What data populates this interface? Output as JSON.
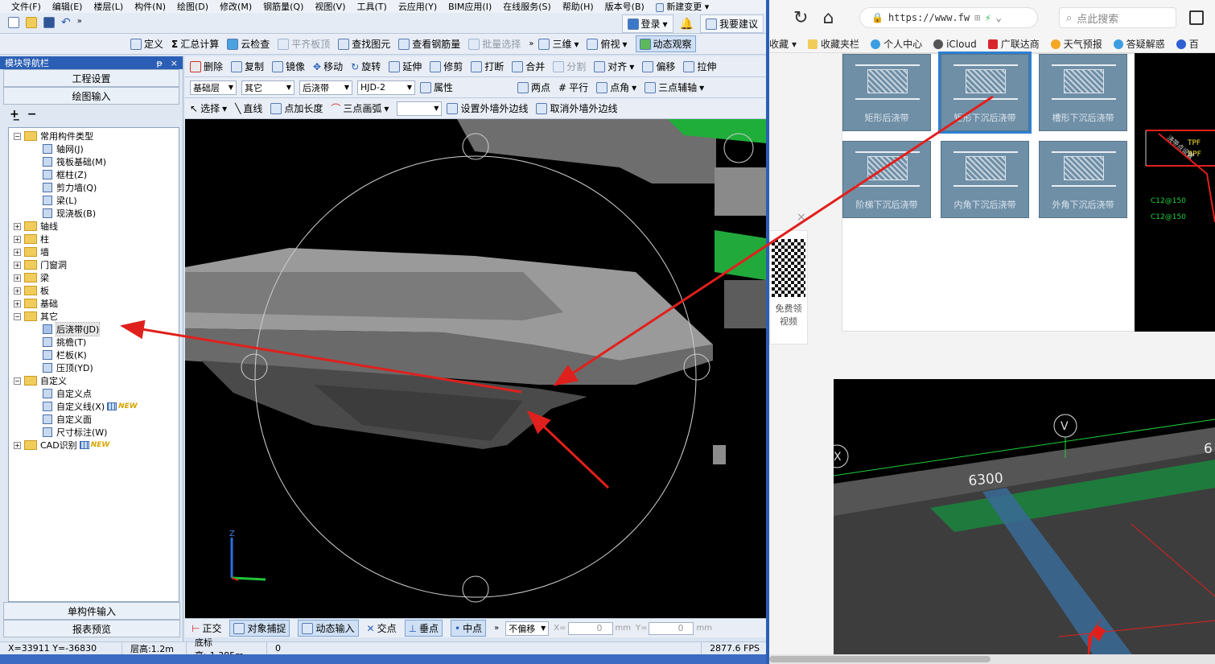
{
  "menu": {
    "items": [
      "文件(F)",
      "编辑(E)",
      "楼层(L)",
      "构件(N)",
      "绘图(D)",
      "修改(M)",
      "钢筋量(Q)",
      "视图(V)",
      "工具(T)",
      "云应用(Y)",
      "BIM应用(I)",
      "在线服务(S)",
      "帮助(H)",
      "版本号(B)"
    ],
    "new_change": "新建变更"
  },
  "row2": {
    "login": "登录",
    "suggest": "我要建议"
  },
  "toolbar1": {
    "define": "定义",
    "sum": "汇总计算",
    "cloud_check": "云检查",
    "level_slab": "平齐板顶",
    "find_elem": "查找图元",
    "view_rebar": "查看钢筋量",
    "batch_select": "批量选择",
    "three_d": "三维",
    "top_view": "俯视",
    "dynamic_view": "动态观察"
  },
  "nav": {
    "title": "模块导航栏",
    "pin": "ᵽ",
    "close": "×",
    "project_settings": "工程设置",
    "drawing_input": "绘图输入",
    "single_input": "单构件输入",
    "report_preview": "报表预览"
  },
  "tree": {
    "common": "常用构件类型",
    "common_items": [
      "轴网(J)",
      "筏板基础(M)",
      "框柱(Z)",
      "剪力墙(Q)",
      "梁(L)",
      "现浇板(B)"
    ],
    "folders": [
      "轴线",
      "柱",
      "墙",
      "门窗洞",
      "梁",
      "板",
      "基础"
    ],
    "other": "其它",
    "other_items": [
      "后浇带(JD)",
      "挑檐(T)",
      "栏板(K)",
      "压顶(YD)"
    ],
    "custom": "自定义",
    "custom_items": [
      "自定义点",
      "自定义线(X)",
      "自定义面",
      "尺寸标注(W)"
    ],
    "cad": "CAD识别",
    "new_badge": "NEW"
  },
  "vtb1": {
    "delete": "删除",
    "copy": "复制",
    "mirror": "镜像",
    "move": "移动",
    "rotate": "旋转",
    "extend": "延伸",
    "trim": "修剪",
    "break": "打断",
    "merge": "合并",
    "split": "分割",
    "align": "对齐",
    "offset": "偏移",
    "stretch": "拉伸"
  },
  "vtb2": {
    "floor": "基础层",
    "category": "其它",
    "type": "后浇带",
    "name": "HJD-2",
    "props": "属性",
    "two_points": "两点",
    "parallel": "平行",
    "point_angle": "点角",
    "three_point_axis": "三点辅轴"
  },
  "vtb3": {
    "select": "选择",
    "line": "直线",
    "point_length": "点加长度",
    "three_arc": "三点画弧",
    "set_outer": "设置外墙外边线",
    "cancel_outer": "取消外墙外边线"
  },
  "snapbar": {
    "ortho": "正交",
    "snap": "对象捕捉",
    "dyn_input": "动态输入",
    "intersection": "交点",
    "perp": "垂点",
    "mid": "中点",
    "no_offset": "不偏移",
    "x_label": "X=",
    "x_val": "0",
    "y_label": "Y=",
    "y_val": "0",
    "unit": "mm"
  },
  "status": {
    "coords": "X=33911 Y=-36830",
    "floor_height": "层高:1.2m",
    "bottom_elev": "底标高:-1.385m",
    "zero": "0",
    "fps": "2877.6 FPS"
  },
  "browser": {
    "url": "https://www.fw",
    "search": "点此搜索",
    "bookmarks": [
      "收藏",
      "收藏夹栏",
      "个人中心",
      "iCloud",
      "广联达商",
      "天气预报",
      "答疑解惑",
      "百"
    ],
    "tiles": [
      "矩形后浇带",
      "矩形下沉后浇带",
      "槽形下沉后浇带",
      "阶梯下沉后浇带",
      "内角下沉后浇带",
      "外角下沉后浇带"
    ],
    "qr_line1": "免费领",
    "qr_line2": "视频",
    "close": "×",
    "cad_texts": [
      "TPF",
      "BPF",
      "C12@150",
      "C12@150",
      "浇带点设置"
    ],
    "dim_label": "6300",
    "axis_v": "V",
    "axis_x": "X",
    "axis_6": "6"
  },
  "colors": {
    "title_blue": "#2b5fb5",
    "arrow_red": "#e0201c",
    "tile": "#6f8fa6",
    "green": "#1f9e3d"
  }
}
